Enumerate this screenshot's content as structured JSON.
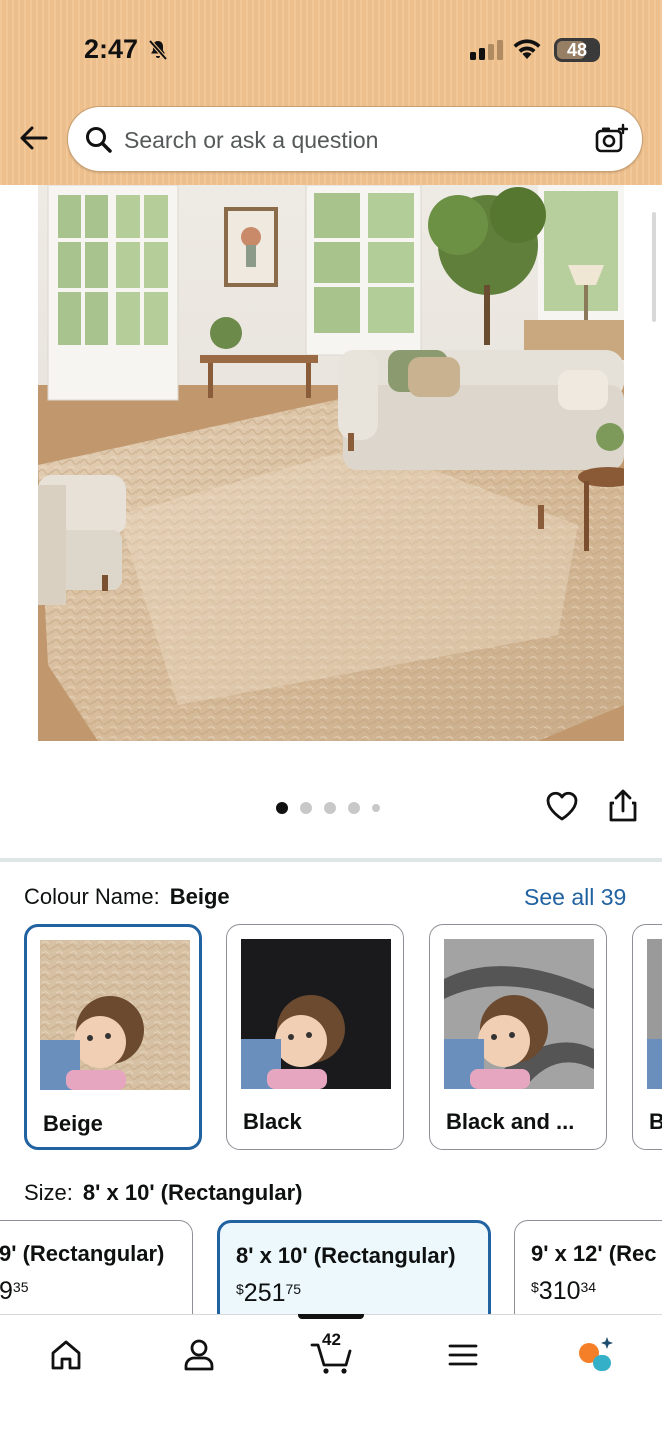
{
  "status_bar": {
    "time": "2:47",
    "battery": "48"
  },
  "search": {
    "placeholder": "Search or ask a question"
  },
  "product": {
    "image_alt": "Beige shag area rug in living room",
    "carousel": {
      "pages": 5,
      "active": 1
    }
  },
  "colour": {
    "label": "Colour Name:",
    "selected": "Beige",
    "see_all": "See all 39",
    "swatches": [
      {
        "name": "Beige",
        "color": "#d7c1a5"
      },
      {
        "name": "Black",
        "color": "#1a1a1c"
      },
      {
        "name": "Black and ...",
        "color": "#8c8c8c"
      },
      {
        "name": "B",
        "color": "#9a9a9a"
      }
    ]
  },
  "size": {
    "label": "Size:",
    "selected": "8' x 10' (Rectangular)",
    "options": [
      {
        "title": "9' (Rectangular)",
        "price_dollars": "",
        "price_cents": "35"
      },
      {
        "title": "8' x 10' (Rectangular)",
        "price_symbol": "$",
        "price_dollars": "251",
        "price_cents": "75"
      },
      {
        "title": "9' x 12' (Rec",
        "price_symbol": "$",
        "price_dollars": "310",
        "price_cents": "34"
      }
    ],
    "partial_price_prefix": "9"
  },
  "bottom_nav": {
    "cart_count": "42"
  },
  "colors": {
    "header": "#f2c38f",
    "link": "#2162a1",
    "selected_border": "#2162a1",
    "selected_bg": "#edf8fd"
  }
}
